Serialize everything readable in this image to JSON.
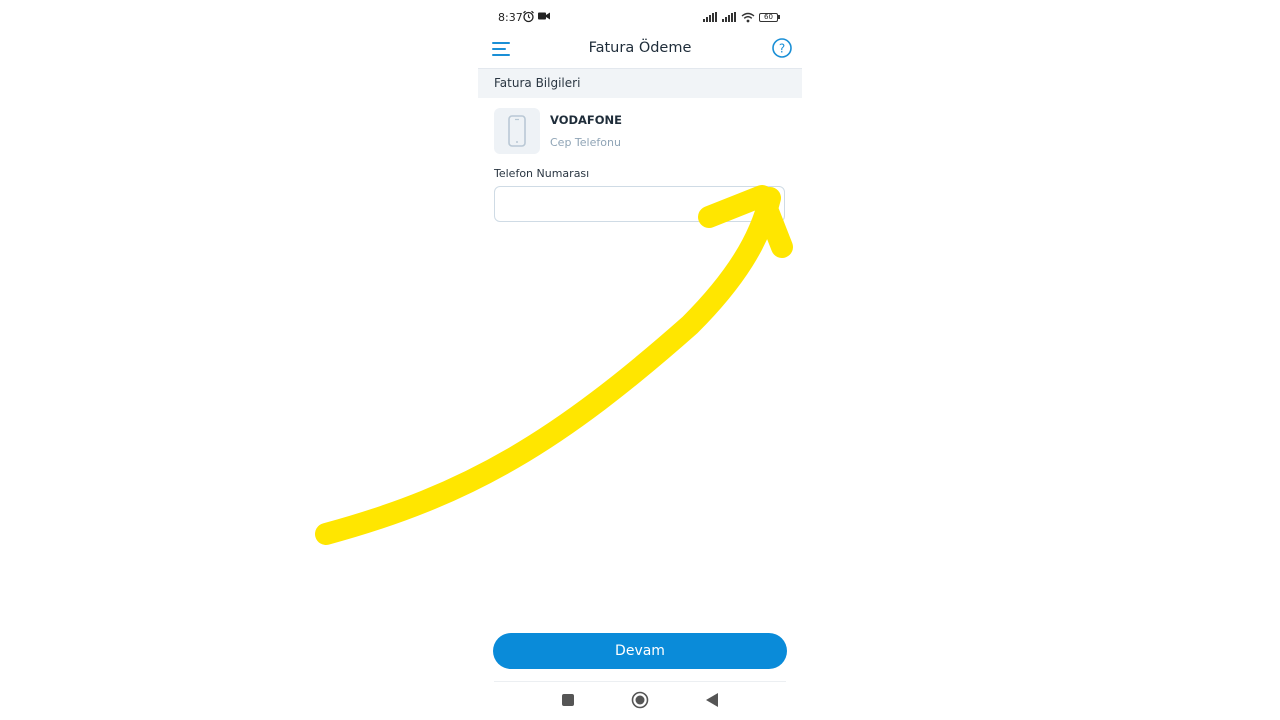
{
  "status_bar": {
    "time": "8:37",
    "battery": "60",
    "icons": [
      "alarm-icon",
      "video-camera-icon",
      "signal-icon",
      "signal-icon",
      "wifi-icon",
      "battery-icon"
    ]
  },
  "header": {
    "title": "Fatura Ödeme",
    "left_icon": "hamburger-menu-icon",
    "right_icon": "help-icon"
  },
  "section": {
    "title": "Fatura Bilgileri"
  },
  "operator": {
    "name": "VODAFONE",
    "type": "Cep Telefonu",
    "icon": "mobile-phone-icon"
  },
  "phone_field": {
    "label": "Telefon Numarası",
    "value": "",
    "placeholder": ""
  },
  "actions": {
    "continue_label": "Devam"
  },
  "nav": {
    "icons": [
      "recents-icon",
      "home-icon",
      "back-icon"
    ]
  },
  "colors": {
    "accent": "#0a8bd9",
    "section_bg": "#f1f4f7",
    "muted_text": "#8fa4b6",
    "annotation_arrow": "#ffe600"
  }
}
